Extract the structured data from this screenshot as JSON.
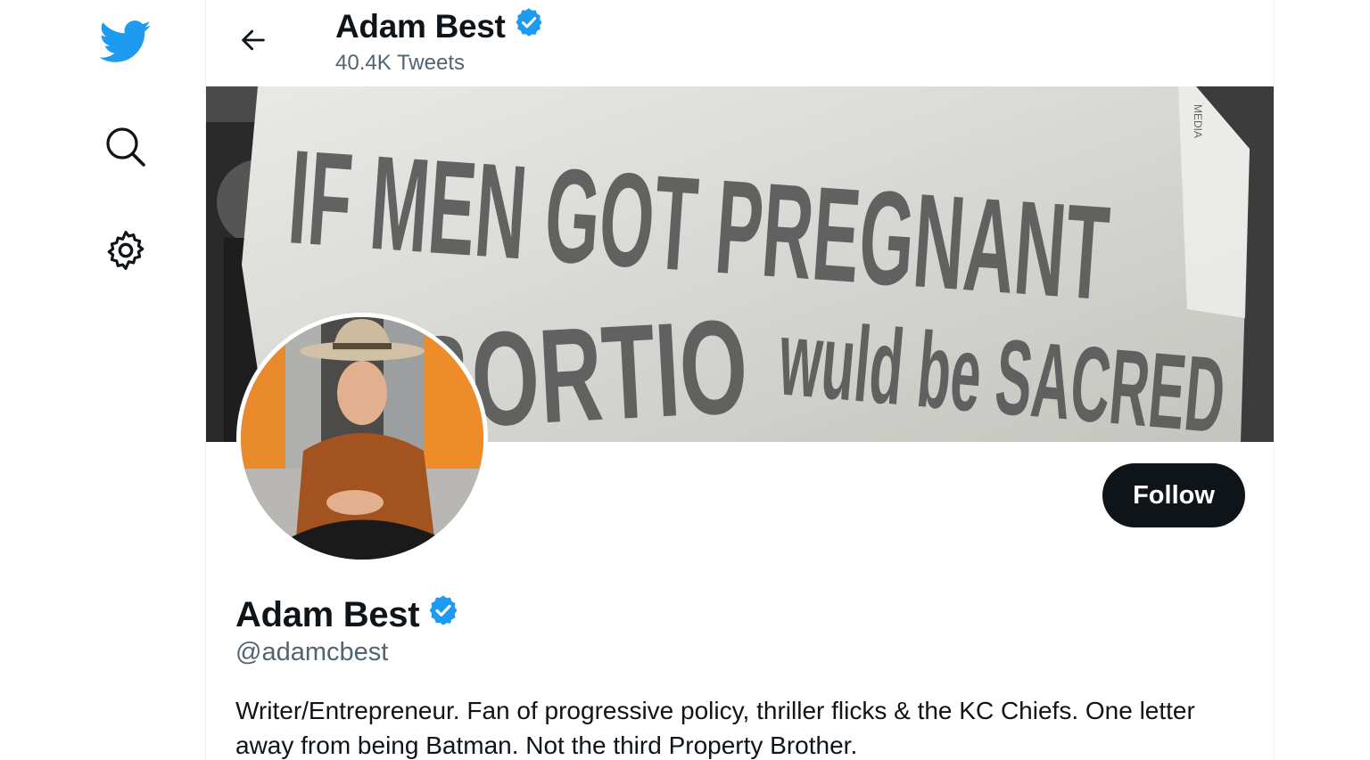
{
  "colors": {
    "twitter_blue": "#1d9bf0",
    "text_primary": "#0f1419",
    "text_secondary": "#536471",
    "follow_bg": "#0f1419",
    "verified": "#1d9bf0"
  },
  "sidebar": {
    "items": [
      {
        "icon": "twitter-logo-icon"
      },
      {
        "icon": "search-icon"
      },
      {
        "icon": "settings-gear-icon"
      }
    ]
  },
  "header": {
    "name": "Adam Best",
    "tweet_count": "40.4K Tweets"
  },
  "banner": {
    "line1": "IF MEN GOT PREGNANT",
    "line2": "BORTIO",
    "line3": "wuld be SACRED",
    "side_text": "MEDIA"
  },
  "profile": {
    "name": "Adam Best",
    "handle": "@adamcbest",
    "bio": "Writer/Entrepreneur. Fan of progressive policy, thriller flicks & the KC Chiefs. One letter away from being Batman. Not the third Property Brother.",
    "follow_label": "Follow"
  }
}
